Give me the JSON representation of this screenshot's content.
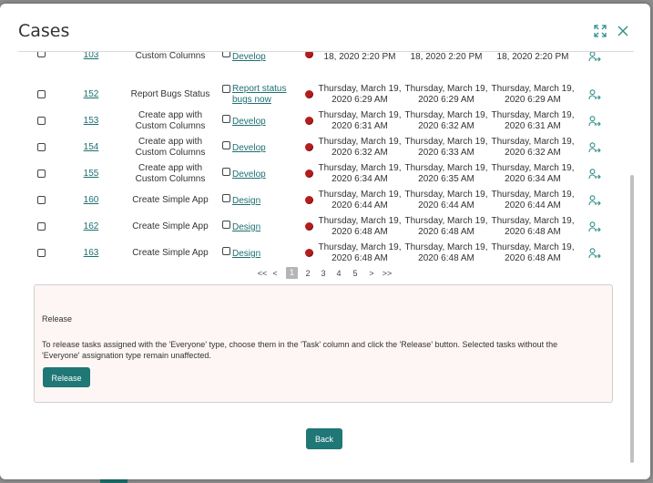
{
  "modal": {
    "title": "Cases"
  },
  "rows": [
    {
      "id": "103",
      "name": "Custom Columns",
      "task": "Develop",
      "start": "18, 2020 2:20 PM",
      "end": "18, 2020 2:20 PM",
      "due": "18, 2020 2:20 PM"
    },
    {
      "id": "152",
      "name": "Report Bugs Status",
      "task": "Report status bugs now",
      "start": "Thursday, March 19, 2020 6:29 AM",
      "end": "Thursday, March 19, 2020 6:29 AM",
      "due": "Thursday, March 19, 2020 6:29 AM"
    },
    {
      "id": "153",
      "name": "Create app with Custom Columns",
      "task": "Develop",
      "start": "Thursday, March 19, 2020 6:31 AM",
      "end": "Thursday, March 19, 2020 6:32 AM",
      "due": "Thursday, March 19, 2020 6:31 AM"
    },
    {
      "id": "154",
      "name": "Create app with Custom Columns",
      "task": "Develop",
      "start": "Thursday, March 19, 2020 6:32 AM",
      "end": "Thursday, March 19, 2020 6:33 AM",
      "due": "Thursday, March 19, 2020 6:32 AM"
    },
    {
      "id": "155",
      "name": "Create app with Custom Columns",
      "task": "Develop",
      "start": "Thursday, March 19, 2020 6:34 AM",
      "end": "Thursday, March 19, 2020 6:35 AM",
      "due": "Thursday, March 19, 2020 6:34 AM"
    },
    {
      "id": "160",
      "name": "Create Simple App",
      "task": "Design",
      "start": "Thursday, March 19, 2020 6:44 AM",
      "end": "Thursday, March 19, 2020 6:44 AM",
      "due": "Thursday, March 19, 2020 6:44 AM"
    },
    {
      "id": "162",
      "name": "Create Simple App",
      "task": "Design",
      "start": "Thursday, March 19, 2020 6:48 AM",
      "end": "Thursday, March 19, 2020 6:48 AM",
      "due": "Thursday, March 19, 2020 6:48 AM"
    },
    {
      "id": "163",
      "name": "Create Simple App",
      "task": "Design",
      "start": "Thursday, March 19, 2020 6:48 AM",
      "end": "Thursday, March 19, 2020 6:48 AM",
      "due": "Thursday, March 19, 2020 6:48 AM"
    }
  ],
  "pagination": {
    "first": "<<",
    "prev": "<",
    "pages": [
      "1",
      "2",
      "3",
      "4",
      "5"
    ],
    "current": "1",
    "next": ">",
    "last": ">>"
  },
  "release": {
    "title": "Release",
    "description": "To release tasks assigned with the 'Everyone' type, choose them in the 'Task' column and click the 'Release' button. Selected tasks without the 'Everyone' assignation type remain unaffected.",
    "button_label": "Release"
  },
  "footer": {
    "back_label": "Back"
  },
  "colors": {
    "accent": "#1f7776",
    "link": "#1e6f72",
    "status_dot": "#b71c1c"
  },
  "icons": {
    "expand": "expand-icon",
    "close": "close-icon",
    "assign": "assign-user-icon",
    "status": "status-dot-icon"
  }
}
